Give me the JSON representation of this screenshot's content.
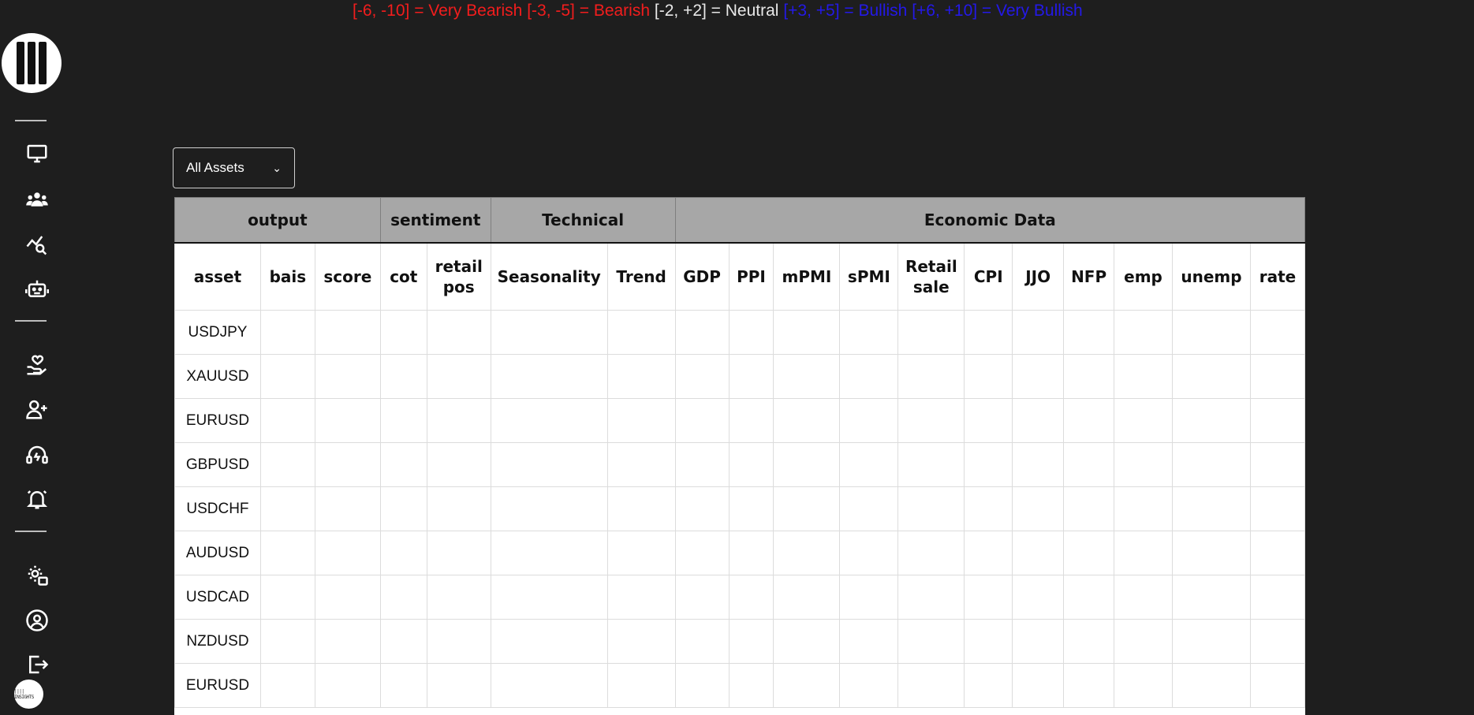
{
  "legend": {
    "very_bearish": "[-6, -10] = Very Bearish",
    "bearish": "[-3, -5] = Bearish",
    "neutral": "[-2, +2] = Neutral",
    "bullish": "[+3, +5] = Bullish",
    "very_bullish": "[+6, +10] = Very Bullish"
  },
  "filter": {
    "selected": "All Assets"
  },
  "sidebar": {
    "icons": [
      "monitor-icon",
      "users-icon",
      "chart-search-icon",
      "robot-icon",
      "hand-heart-icon",
      "user-plus-icon",
      "headset-icon",
      "alarm-bell-icon",
      "settings-user-icon",
      "user-circle-icon",
      "logout-icon"
    ],
    "mini_logo_text": "|||| INSIGHTS"
  },
  "table": {
    "groups": [
      {
        "label": "output",
        "span": 3
      },
      {
        "label": "sentiment",
        "span": 2
      },
      {
        "label": "Technical",
        "span": 2
      },
      {
        "label": "Economic Data",
        "span": 11
      }
    ],
    "columns": [
      {
        "label": "asset"
      },
      {
        "label": "bais"
      },
      {
        "label": "score"
      },
      {
        "label": "cot"
      },
      {
        "label": "retail pos"
      },
      {
        "label": "Seasonality"
      },
      {
        "label": "Trend"
      },
      {
        "label": "GDP"
      },
      {
        "label": "PPI"
      },
      {
        "label": "mPMI"
      },
      {
        "label": "sPMI"
      },
      {
        "label": "Retail sale"
      },
      {
        "label": "CPI"
      },
      {
        "label": "JJO"
      },
      {
        "label": "NFP"
      },
      {
        "label": "emp"
      },
      {
        "label": "unemp"
      },
      {
        "label": "rate"
      }
    ],
    "rows": [
      "USDJPY",
      "XAUUSD",
      "EURUSD",
      "GBPUSD",
      "USDCHF",
      "AUDUSD",
      "USDCAD",
      "NZDUSD",
      "EURUSD"
    ]
  },
  "colors": {
    "bearish": "#f21d1d",
    "neutral": "#e8e8e8",
    "bullish": "#2419e8",
    "header_bg": "#a7a7a7",
    "page_bg": "#1e1e1e"
  }
}
